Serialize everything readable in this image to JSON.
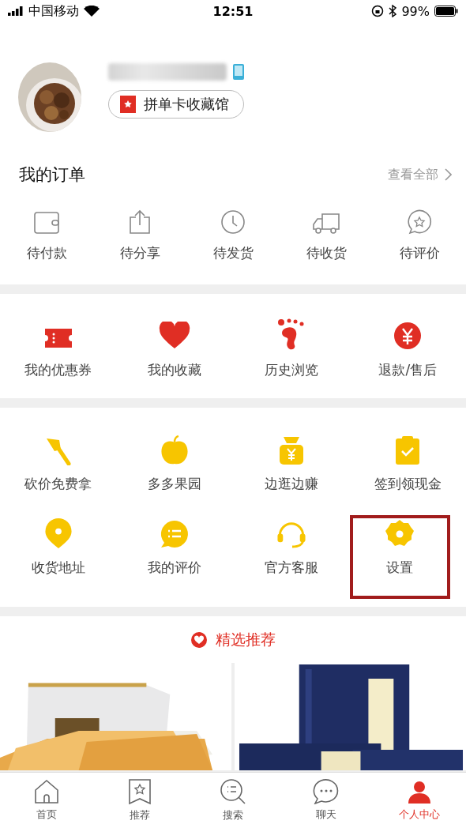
{
  "status_bar": {
    "carrier": "中国移动",
    "time": "12:51",
    "battery": "99%"
  },
  "profile": {
    "badge_label": "拼单卡收藏馆"
  },
  "orders": {
    "title": "我的订单",
    "view_all": "查看全部",
    "items": [
      {
        "label": "待付款"
      },
      {
        "label": "待分享"
      },
      {
        "label": "待发货"
      },
      {
        "label": "待收货"
      },
      {
        "label": "待评价"
      }
    ]
  },
  "services": [
    {
      "label": "我的优惠券"
    },
    {
      "label": "我的收藏"
    },
    {
      "label": "历史浏览"
    },
    {
      "label": "退款/售后"
    }
  ],
  "tools": [
    {
      "label": "砍价免费拿",
      "highlighted": false
    },
    {
      "label": "多多果园",
      "highlighted": false
    },
    {
      "label": "边逛边赚",
      "highlighted": false
    },
    {
      "label": "签到领现金",
      "highlighted": false
    },
    {
      "label": "收货地址",
      "highlighted": false
    },
    {
      "label": "我的评价",
      "highlighted": false
    },
    {
      "label": "官方客服",
      "highlighted": false
    },
    {
      "label": "设置",
      "highlighted": true
    }
  ],
  "recommend": {
    "title": "精选推荐"
  },
  "tab_bar": [
    {
      "label": "首页",
      "selected": false
    },
    {
      "label": "推荐",
      "selected": false
    },
    {
      "label": "搜索",
      "selected": false
    },
    {
      "label": "聊天",
      "selected": false
    },
    {
      "label": "个人中心",
      "selected": true
    }
  ]
}
